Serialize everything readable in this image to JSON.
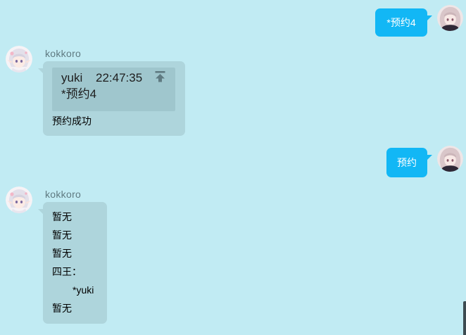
{
  "colors": {
    "background": "#c1ebf3",
    "outgoing_bubble": "#12b7f5",
    "outgoing_text": "#ffffff",
    "incoming_bubble": "#aed5dc",
    "quote_background": "#9fc6cd",
    "sender_name": "#5f7a81",
    "text": "#000000",
    "icon": "#5f7a81"
  },
  "messages": [
    {
      "avatar_icon": "user-avatar-icon",
      "text": "*预约4"
    },
    {
      "avatar_icon": "kokkoro-avatar-icon",
      "sender": "kokkoro",
      "quote": {
        "author": "yuki",
        "time": "22:47:35",
        "text": "*预约4",
        "icon": "jump-to-original-icon"
      },
      "lines": [
        "预约成功"
      ]
    },
    {
      "avatar_icon": "user-avatar-icon",
      "text": "预约"
    },
    {
      "avatar_icon": "kokkoro-avatar-icon",
      "sender": "kokkoro",
      "lines": [
        "暂无",
        "暂无",
        "暂无",
        "四王：",
        "*yuki",
        "暂无"
      ]
    }
  ]
}
